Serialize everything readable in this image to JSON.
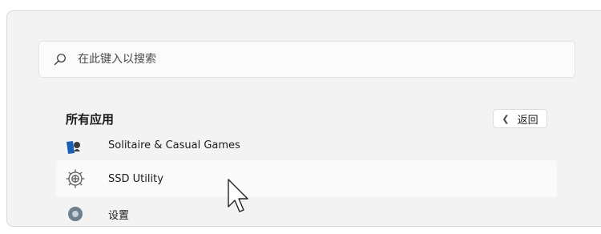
{
  "search": {
    "placeholder": "在此键入以搜索",
    "icon": "search-icon"
  },
  "all_apps": {
    "title": "所有应用",
    "back_label": "返回",
    "back_icon": "chevron-left-icon"
  },
  "apps": [
    {
      "label": "Solitaire & Casual Games",
      "icon": "solitaire-icon"
    },
    {
      "label": "SSD Utility",
      "icon": "gear-icon"
    },
    {
      "label": "设置",
      "icon": "settings-icon"
    }
  ],
  "colors": {
    "panel_bg": "#f3f3f3",
    "search_bg": "#fbfbfb",
    "hover_bg": "#fafafa",
    "solitaire_blue": "#1a5fb4",
    "text": "#1b1b1b"
  }
}
